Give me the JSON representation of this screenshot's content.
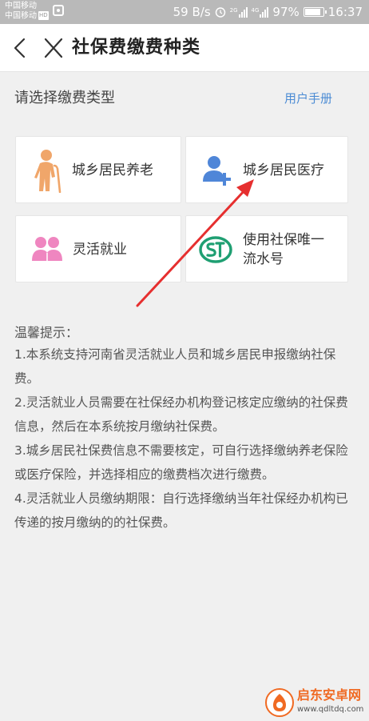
{
  "status_bar": {
    "carrier_1": "中国移动",
    "carrier_2": "中国移动",
    "hd": "HD",
    "net_speed": "59 B/s",
    "network_tag_1": "2G",
    "network_tag_2": "4G",
    "battery_percent": "97%",
    "battery_level": 0.97,
    "time": "16:37"
  },
  "header": {
    "title": "社保费缴费种类",
    "back_icon": "chevron-left-icon",
    "close_icon": "close-icon"
  },
  "section": {
    "label": "请选择缴费类型",
    "manual_link": "用户手册"
  },
  "cards": [
    {
      "label": "城乡居民养老",
      "icon": "elderly-person-icon"
    },
    {
      "label": "城乡居民医疗",
      "icon": "add-user-icon"
    },
    {
      "label": "灵活就业",
      "icon": "group-icon"
    },
    {
      "label_line1": "使用社保唯一",
      "label_line2": "流水号",
      "icon": "si-logo-icon"
    }
  ],
  "tips": {
    "title": "温馨提示：",
    "items": [
      "1.本系统支持河南省灵活就业人员和城乡居民申报缴纳社保费。",
      "2.灵活就业人员需要在社保经办机构登记核定应缴纳的社保费信息，然后在本系统按月缴纳社保费。",
      "3.城乡居民社保费信息不需要核定，可自行选择缴纳养老保险或医疗保险，并选择相应的缴费档次进行缴费。",
      "4.灵活就业人员缴纳期限：自行选择缴纳当年社保经办机构已传递的按月缴纳的的社保费。"
    ]
  },
  "watermark": {
    "text": "启东安卓网",
    "url": "www.qdltdq.com"
  },
  "colors": {
    "accent_blue": "#4b8bd4",
    "elderly_orange": "#f0a66a",
    "user_blue": "#4f86d8",
    "group_pink": "#ef86c0",
    "si_green": "#1f9f72",
    "arrow_red": "#e62f2f"
  }
}
